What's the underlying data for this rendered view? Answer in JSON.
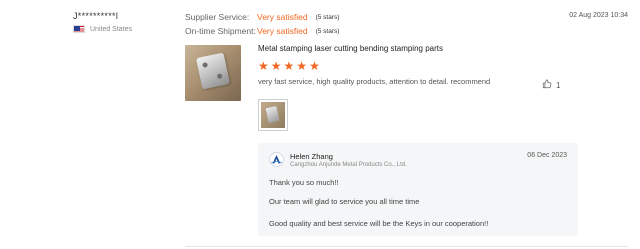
{
  "buyer": {
    "name": "J**********l",
    "country": "United States"
  },
  "ratings": {
    "supplier_service": {
      "label": "Supplier Service:",
      "value": "Very satisfied",
      "stars": "(5 stars)"
    },
    "ontime_shipment": {
      "label": "On-time Shipment:",
      "value": "Very satisfied",
      "stars": "(5 stars)"
    }
  },
  "review": {
    "date": "02 Aug 2023 10:34",
    "product_title": "Metal stamping laser cutting bending stamping parts",
    "star_rating": 5,
    "text": "very fast service, high quality products, attention to detail.  recommend",
    "likes": "1"
  },
  "reply": {
    "supplier_name": "Helen Zhang",
    "company": "Cangzhou Anjunde Metal Products Co., Ltd.",
    "date": "06 Dec 2023",
    "lines": [
      "Thank you so much!!",
      "Our team will glad to service you all time time",
      "Good quality and best service will be the Keys in our cooperation!!"
    ]
  },
  "colors": {
    "accent": "#f26822",
    "reply_bg": "#f5f6f7"
  },
  "icons": {
    "like": "thumbs-up-icon",
    "flag": "us-flag-icon",
    "star": "star-icon"
  }
}
